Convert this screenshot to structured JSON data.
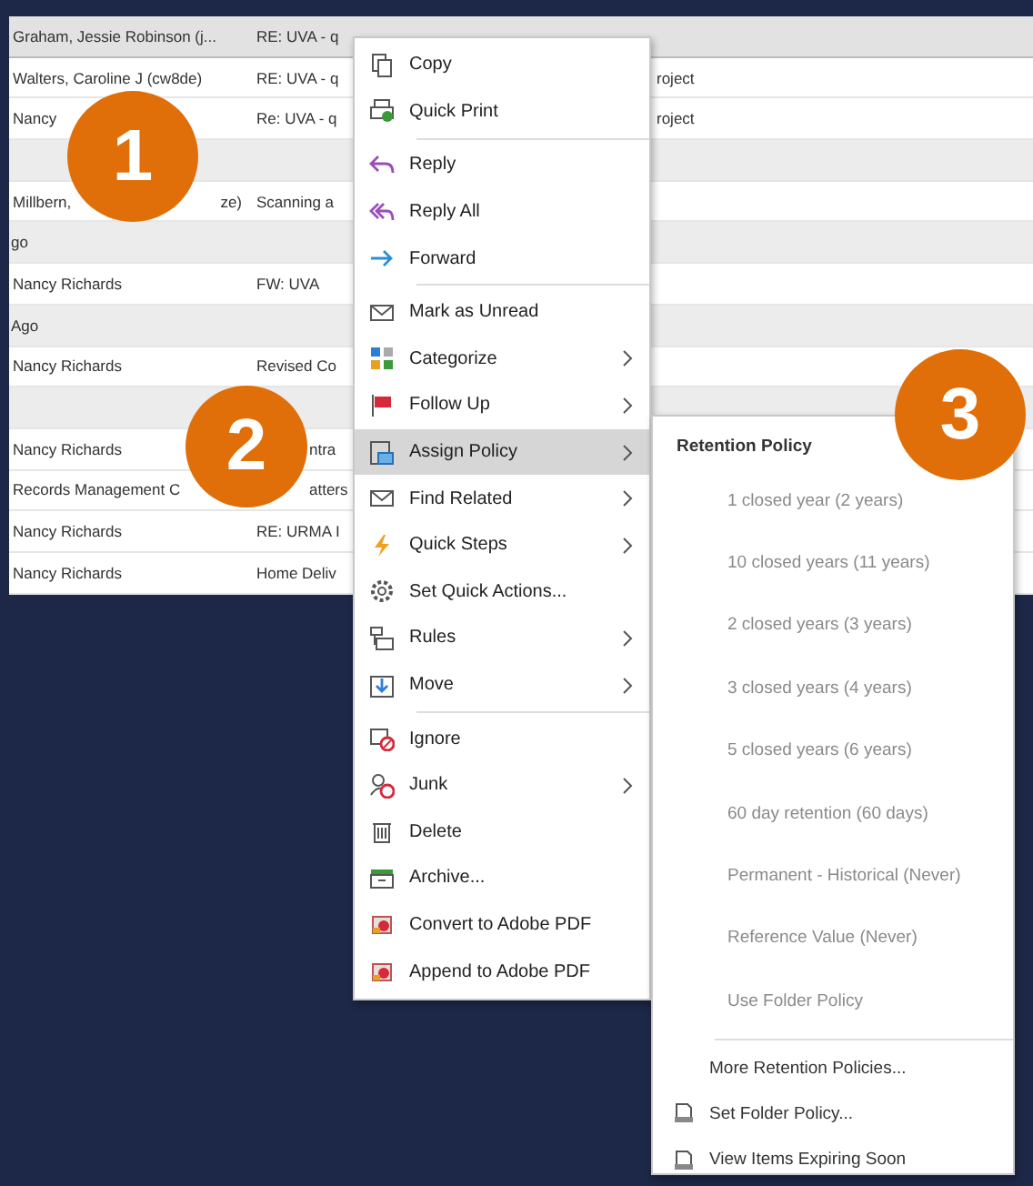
{
  "message_list": {
    "rows": [
      {
        "kind": "email",
        "sender": "Graham, Jessie Robinson (j...",
        "subject": "RE: UVA - q",
        "selected": true
      },
      {
        "kind": "email",
        "sender": "Walters, Caroline J (cw8de)",
        "subject": "RE: UVA - q",
        "subject_tail": "roject",
        "selected": false
      },
      {
        "kind": "email",
        "sender": "Nancy",
        "subject": "Re: UVA - q",
        "subject_tail": "roject",
        "selected": false
      },
      {
        "kind": "group"
      },
      {
        "kind": "email",
        "sender": "Millbern,",
        "sender_tail": "ze)",
        "subject": "Scanning a",
        "selected": false
      },
      {
        "kind": "group",
        "label": "go"
      },
      {
        "kind": "email",
        "sender": "Nancy Richards",
        "subject": "FW: UVA",
        "selected": false
      },
      {
        "kind": "group",
        "label": "Ago"
      },
      {
        "kind": "email",
        "sender": "Nancy Richards",
        "subject": "Revised Co",
        "selected": false
      },
      {
        "kind": "group"
      },
      {
        "kind": "email",
        "sender": "Nancy Richards",
        "subject": "ntra",
        "selected": false,
        "subject_behind_callout": true
      },
      {
        "kind": "email",
        "sender": "Records Management C",
        "subject": "atters",
        "selected": false,
        "subject_behind_callout": true
      },
      {
        "kind": "email",
        "sender": "Nancy Richards",
        "subject": "RE: URMA I",
        "selected": false
      },
      {
        "kind": "email",
        "sender": "Nancy Richards",
        "subject": "Home Deliv",
        "selected": false
      }
    ]
  },
  "context_menu": {
    "groups": [
      [
        {
          "label": "Copy",
          "has_submenu": false,
          "selected": false
        },
        {
          "label": "Quick Print",
          "has_submenu": false,
          "selected": false
        }
      ],
      [
        {
          "label": "Reply",
          "has_submenu": false,
          "selected": false
        },
        {
          "label": "Reply All",
          "has_submenu": false,
          "selected": false
        },
        {
          "label": "Forward",
          "has_submenu": false,
          "selected": false
        }
      ],
      [
        {
          "label": "Mark as Unread",
          "has_submenu": false,
          "selected": false
        },
        {
          "label": "Categorize",
          "has_submenu": true,
          "selected": false
        },
        {
          "label": "Follow Up",
          "has_submenu": true,
          "selected": false
        },
        {
          "label": "Assign Policy",
          "has_submenu": true,
          "selected": true
        },
        {
          "label": "Find Related",
          "has_submenu": true,
          "selected": false
        },
        {
          "label": "Quick Steps",
          "has_submenu": true,
          "selected": false
        },
        {
          "label": "Set Quick Actions...",
          "has_submenu": false,
          "selected": false
        },
        {
          "label": "Rules",
          "has_submenu": true,
          "selected": false
        },
        {
          "label": "Move",
          "has_submenu": true,
          "selected": false
        }
      ],
      [
        {
          "label": "Ignore",
          "has_submenu": false,
          "selected": false
        },
        {
          "label": "Junk",
          "has_submenu": true,
          "selected": false
        },
        {
          "label": "Delete",
          "has_submenu": false,
          "selected": false
        },
        {
          "label": "Archive...",
          "has_submenu": false,
          "selected": false
        },
        {
          "label": "Convert to Adobe PDF",
          "has_submenu": false,
          "selected": false
        },
        {
          "label": "Append to Adobe PDF",
          "has_submenu": false,
          "selected": false
        }
      ]
    ]
  },
  "submenu": {
    "title": "Retention Policy",
    "policies": [
      {
        "label": "1 closed year (2 years)",
        "disabled": true
      },
      {
        "label": "10 closed years (11 years)",
        "disabled": true
      },
      {
        "label": "2 closed years (3 years)",
        "disabled": true
      },
      {
        "label": "3 closed years (4 years)",
        "disabled": true
      },
      {
        "label": "5 closed years (6 years)",
        "disabled": true
      },
      {
        "label": "60 day retention (60 days)",
        "disabled": true
      },
      {
        "label": "Permanent - Historical (Never)",
        "disabled": true
      },
      {
        "label": "Reference Value (Never)",
        "disabled": true
      },
      {
        "label": "Use Folder Policy",
        "disabled": true
      }
    ],
    "actions": [
      {
        "label": "More Retention Policies...",
        "kind": "plain"
      },
      {
        "label": "Set Folder Policy...",
        "kind": "document"
      },
      {
        "label": "View Items Expiring Soon",
        "kind": "document"
      }
    ]
  },
  "callouts": [
    "1",
    "2",
    "3"
  ]
}
